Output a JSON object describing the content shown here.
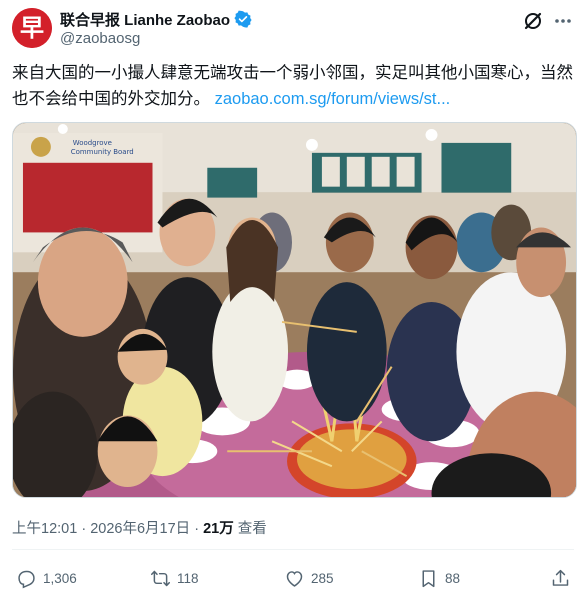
{
  "account": {
    "display_name": "联合早报 Lianhe Zaobao",
    "handle": "@zaobaosg",
    "avatar_glyph": "早",
    "avatar_color": "#d3202a",
    "verified_color": "#1d9bf0"
  },
  "tweet": {
    "text": "来自大国的一小撮人肆意无端攻击一个弱小邻国，实足叫其他小国寒心，当然也不会给中国的外交加分。",
    "link": "zaobao.com.sg/forum/views/st..."
  },
  "media": {
    "wall_text_line1": "Woodgrove",
    "wall_text_line2": "Community Board"
  },
  "meta": {
    "time": "上午12:01",
    "separator": "·",
    "date": "2026年6月17日",
    "views_count": "21万",
    "views_label": "查看"
  },
  "actions": {
    "replies": "1,306",
    "reposts": "118",
    "likes": "285",
    "bookmarks": "88"
  },
  "colors": {
    "text": "#0f1419",
    "secondary": "#536471",
    "link": "#1d9bf0"
  }
}
